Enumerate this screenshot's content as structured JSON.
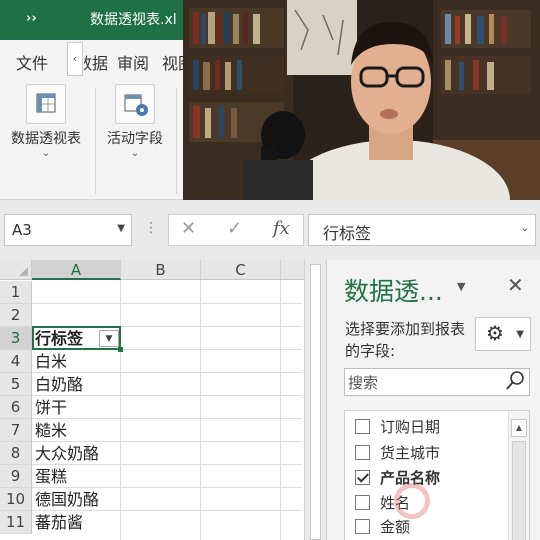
{
  "window": {
    "collapse_glyph": "››",
    "file_name": "数据透视表.xl"
  },
  "ribbon_tabs": {
    "file": "文件",
    "scroll_left_glyph": "‹",
    "data": "数据",
    "review": "审阅",
    "view": "视图"
  },
  "ribbon": {
    "pivot_table": {
      "label": "数据透视表",
      "dropdown": "⌄",
      "icon": "pivot-table-icon"
    },
    "active_field": {
      "label": "活动字段",
      "dropdown": "⌄",
      "icon": "active-field-icon"
    }
  },
  "formula_bar": {
    "name_box": "A3",
    "cancel_glyph": "✕",
    "enter_glyph": "✓",
    "fx_glyph": "fx",
    "content": "行标签"
  },
  "sheet": {
    "columns": [
      "A",
      "B",
      "C"
    ],
    "rows": [
      "1",
      "2",
      "3",
      "4",
      "5",
      "6",
      "7",
      "8",
      "9",
      "10",
      "11"
    ],
    "cells": {
      "a3": "行标签",
      "a4": "白米",
      "a5": "白奶酪",
      "a6": "饼干",
      "a7": "糙米",
      "a8": "大众奶酪",
      "a9": "蛋糕",
      "a10": "德国奶酪",
      "a11": "蕃茄酱"
    },
    "selected_cell": "A3"
  },
  "pivot_pane": {
    "title": "数据透...",
    "subtitle": "选择要添加到报表的字段:",
    "search_placeholder": "搜索",
    "fields": [
      {
        "label": "订购日期",
        "checked": false
      },
      {
        "label": "货主城市",
        "checked": false
      },
      {
        "label": "产品名称",
        "checked": true
      },
      {
        "label": "姓名",
        "checked": false
      },
      {
        "label": "金额",
        "checked": false
      }
    ]
  },
  "colors": {
    "excel_green": "#217346",
    "title_bar": "#1e7145",
    "pane_title": "#217346"
  }
}
